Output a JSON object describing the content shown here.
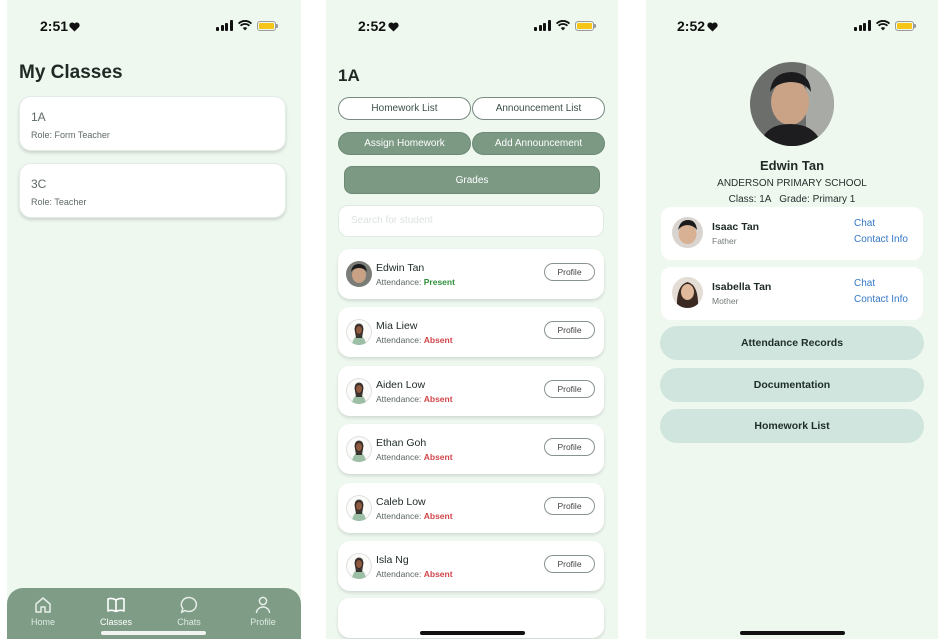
{
  "colors": {
    "background": "#eef8ef",
    "tab_bar": "#7e9c86",
    "filled_button": "#7b9983",
    "light_button": "#cfe5de",
    "present": "#2f8f3a",
    "absent": "#d1454a",
    "link": "#3478c6"
  },
  "screen1": {
    "status": {
      "time": "2:51"
    },
    "title": "My Classes",
    "classes": [
      {
        "name": "1A",
        "role": "Role: Form Teacher"
      },
      {
        "name": "3C",
        "role": "Role: Teacher"
      }
    ],
    "tabs": [
      {
        "label": "Home",
        "icon": "home-icon"
      },
      {
        "label": "Classes",
        "icon": "book-icon",
        "active": true
      },
      {
        "label": "Chats",
        "icon": "chat-bubble-icon"
      },
      {
        "label": "Profile",
        "icon": "person-icon"
      }
    ]
  },
  "screen2": {
    "status": {
      "time": "2:52"
    },
    "title": "1A",
    "buttons": {
      "homework_list": "Homework List",
      "announcement_list": "Announcement List",
      "assign_homework": "Assign Homework",
      "add_announcement": "Add Announcement",
      "grades": "Grades"
    },
    "search_placeholder": "Search for student",
    "attendance_label": "Attendance:",
    "profile_label": "Profile",
    "students": [
      {
        "name": "Edwin Tan",
        "status": "Present"
      },
      {
        "name": "Mia Liew",
        "status": "Absent"
      },
      {
        "name": "Aiden Low",
        "status": "Absent"
      },
      {
        "name": "Ethan Goh",
        "status": "Absent"
      },
      {
        "name": "Caleb Low",
        "status": "Absent"
      },
      {
        "name": "Isla Ng",
        "status": "Absent"
      }
    ]
  },
  "screen3": {
    "status": {
      "time": "2:52"
    },
    "student_name": "Edwin Tan",
    "school": "ANDERSON PRIMARY SCHOOL",
    "class_info": "Class: 1A   Grade: Primary 1",
    "parents": [
      {
        "name": "Isaac Tan",
        "relation": "Father",
        "chat": "Chat",
        "contact": "Contact Info"
      },
      {
        "name": "Isabella Tan",
        "relation": "Mother",
        "chat": "Chat",
        "contact": "Contact Info"
      }
    ],
    "actions": [
      "Attendance Records",
      "Documentation",
      "Homework List"
    ]
  }
}
